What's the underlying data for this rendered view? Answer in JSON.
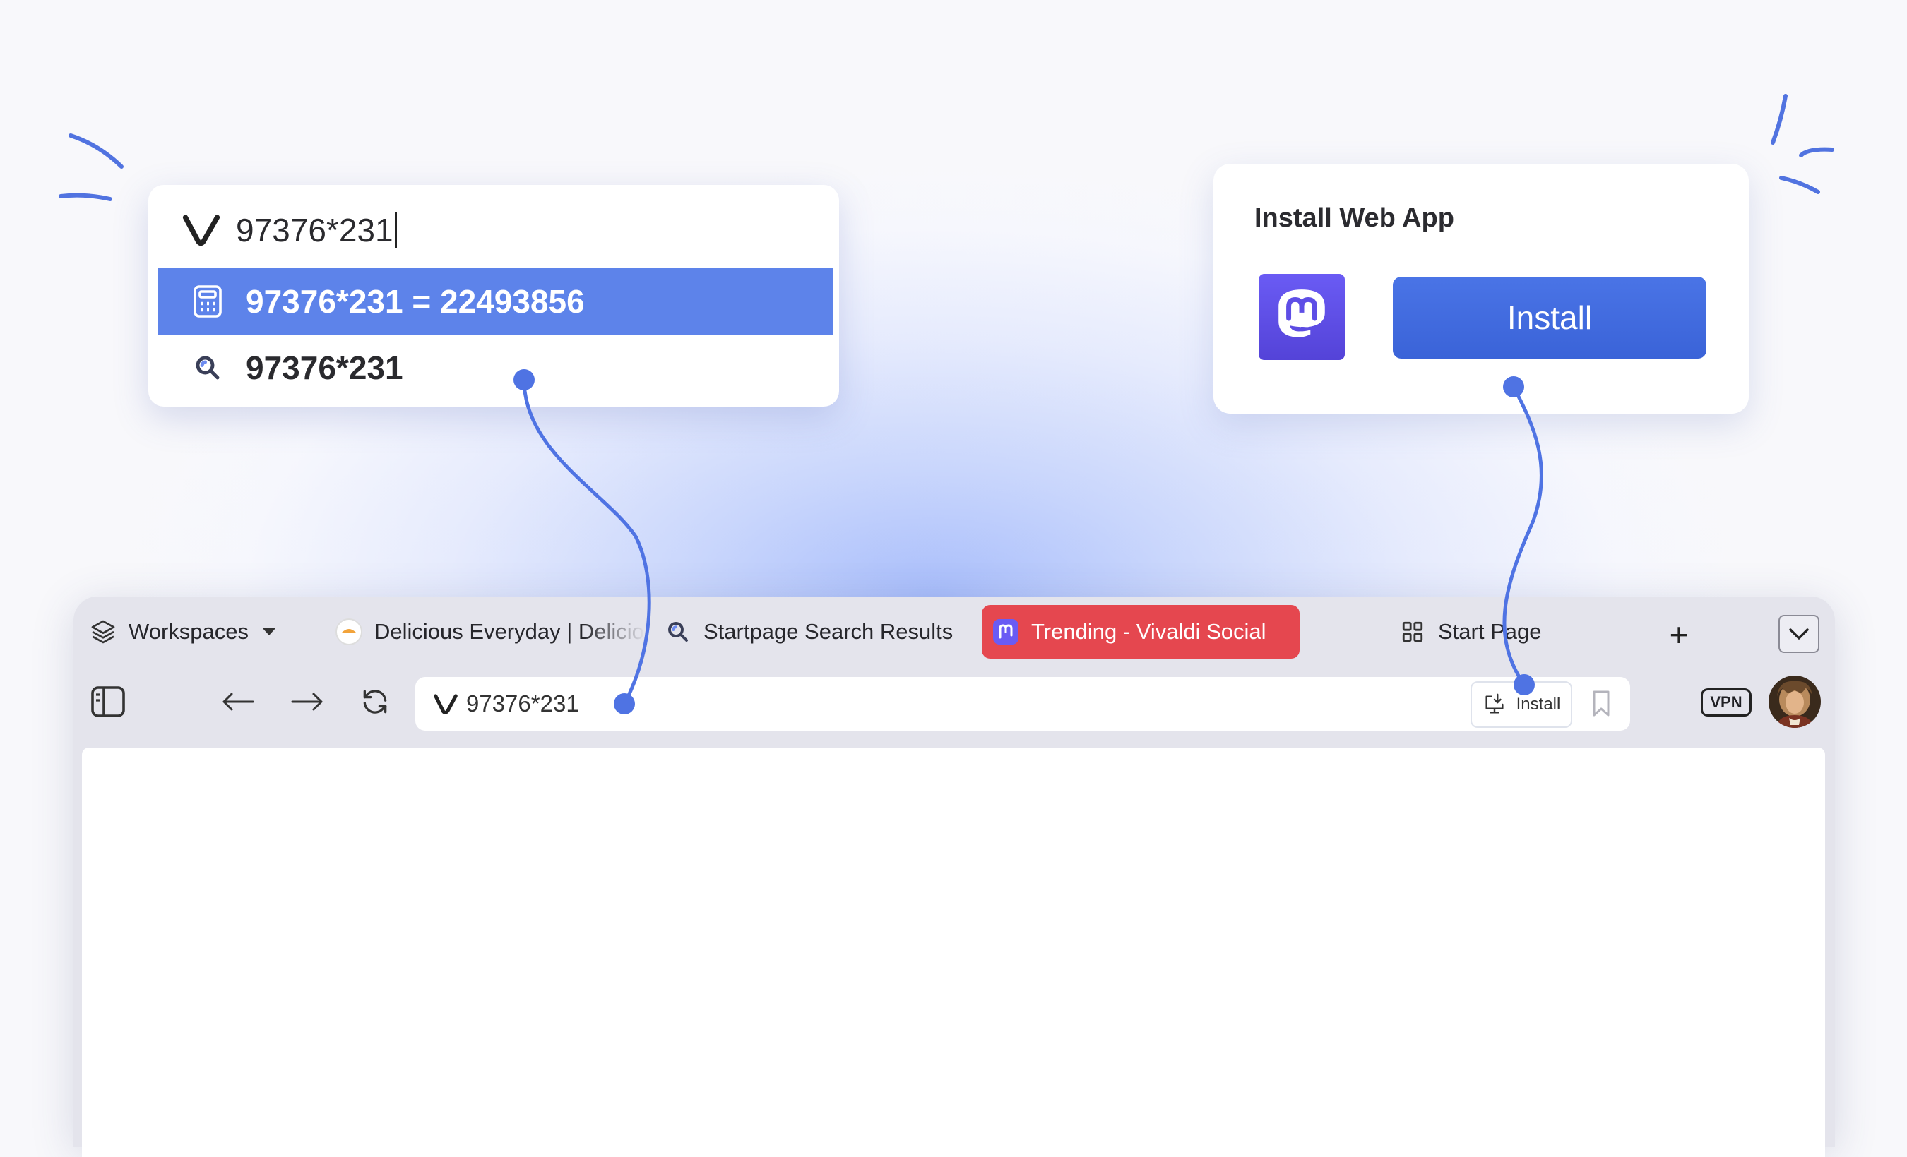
{
  "omnibox_popup": {
    "input_value": "97376*231",
    "calculator_result": "97376*231 = 22493856",
    "search_suggestion": "97376*231"
  },
  "install_card": {
    "title": "Install Web App",
    "install_label": "Install",
    "app_icon": "mastodon-icon"
  },
  "tabs": {
    "workspaces_label": "Workspaces",
    "items": [
      {
        "label": "Delicious Everyday | Delicious",
        "icon": "delicious-icon",
        "active": false
      },
      {
        "label": "Startpage Search Results",
        "icon": "startpage-icon",
        "active": false
      },
      {
        "label": "Trending - Vivaldi Social",
        "icon": "mastodon-icon",
        "active": true
      },
      {
        "label": "Start Page",
        "icon": "grid-icon",
        "active": false
      }
    ],
    "new_tab": "+"
  },
  "toolbar": {
    "url_value": "97376*231",
    "install_label": "Install",
    "vpn_label": "VPN"
  },
  "colors": {
    "accent": "#5d83ea",
    "active_tab": "#e5474f",
    "install_button": "#3a63d8",
    "connector": "#4f73e3"
  }
}
